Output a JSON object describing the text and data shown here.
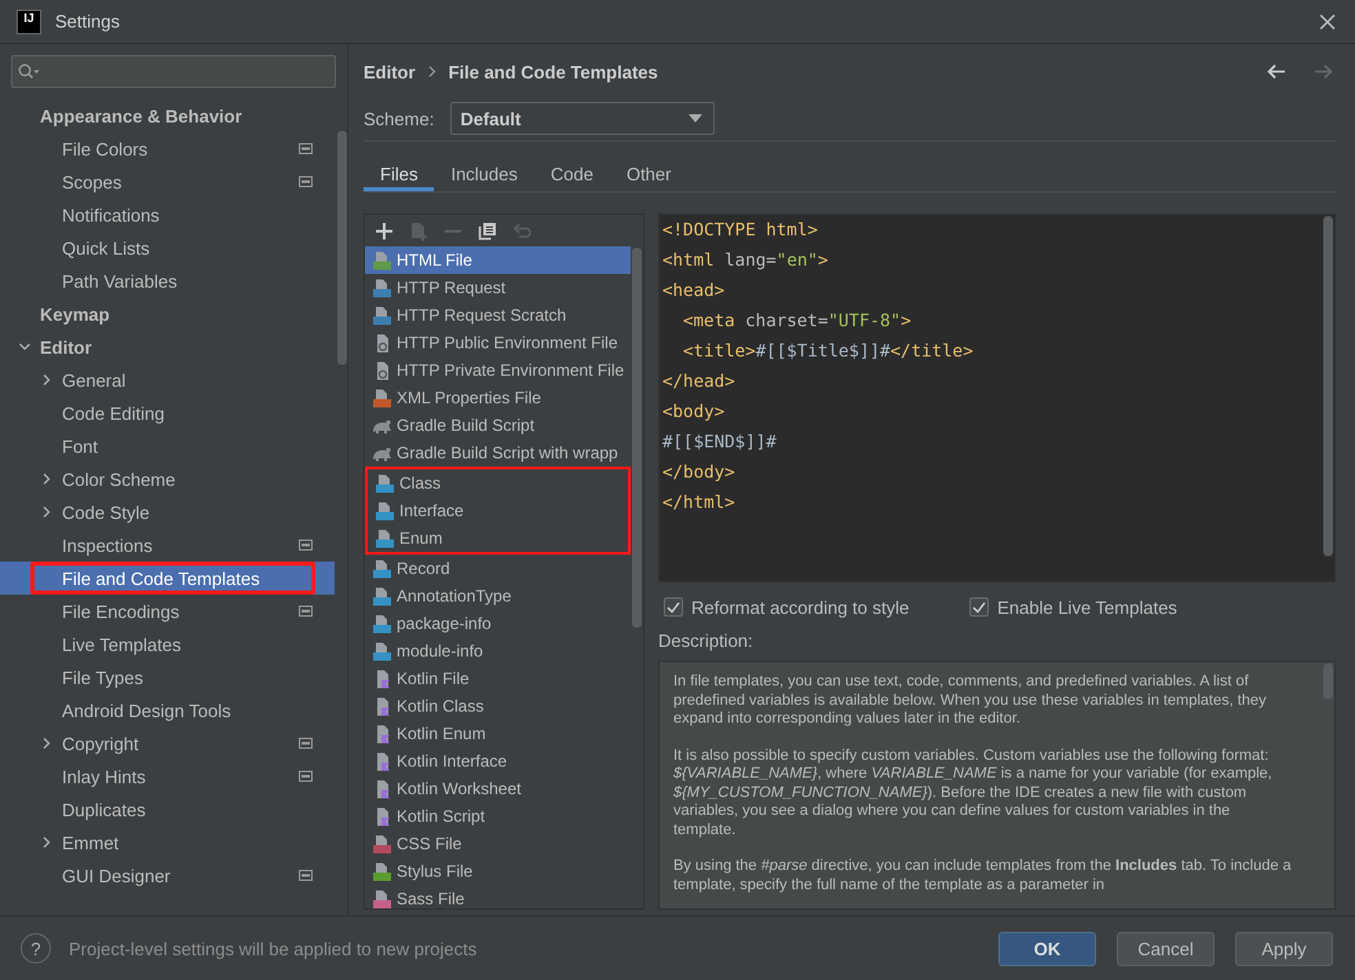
{
  "window": {
    "logo": "IJ",
    "title": "Settings"
  },
  "sidebar": {
    "items": [
      {
        "label": "Appearance & Behavior",
        "kind": "header",
        "children": [
          {
            "label": "File Colors",
            "project_level": true
          },
          {
            "label": "Scopes",
            "project_level": true
          },
          {
            "label": "Notifications"
          },
          {
            "label": "Quick Lists"
          },
          {
            "label": "Path Variables"
          }
        ]
      },
      {
        "label": "Keymap",
        "kind": "header"
      },
      {
        "label": "Editor",
        "kind": "header",
        "expanded": true,
        "children": [
          {
            "label": "General",
            "expanded": false
          },
          {
            "label": "Code Editing"
          },
          {
            "label": "Font"
          },
          {
            "label": "Color Scheme",
            "expanded": false
          },
          {
            "label": "Code Style",
            "expanded": false
          },
          {
            "label": "Inspections",
            "project_level": true
          },
          {
            "label": "File and Code Templates",
            "selected": true,
            "boxed": true
          },
          {
            "label": "File Encodings",
            "project_level": true
          },
          {
            "label": "Live Templates"
          },
          {
            "label": "File Types"
          },
          {
            "label": "Android Design Tools"
          },
          {
            "label": "Copyright",
            "expanded": false,
            "project_level": true
          },
          {
            "label": "Inlay Hints",
            "project_level": true
          },
          {
            "label": "Duplicates"
          },
          {
            "label": "Emmet",
            "expanded": false
          },
          {
            "label": "GUI Designer",
            "project_level": true
          }
        ]
      }
    ]
  },
  "breadcrumb": [
    "Editor",
    "File and Code Templates"
  ],
  "scheme": {
    "label": "Scheme:",
    "value": "Default"
  },
  "tabs": [
    {
      "label": "Files",
      "selected": true
    },
    {
      "label": "Includes",
      "selected": false
    },
    {
      "label": "Code",
      "selected": false
    },
    {
      "label": "Other",
      "selected": false
    }
  ],
  "toolbar": [
    {
      "kind": "add",
      "disabled": false
    },
    {
      "kind": "add-child",
      "disabled": true
    },
    {
      "kind": "remove",
      "disabled": true
    },
    {
      "kind": "copy",
      "disabled": false
    },
    {
      "kind": "reset",
      "disabled": true
    }
  ],
  "templates": [
    {
      "label": "HTML File",
      "kind": "html",
      "selected": true,
      "boxed": false
    },
    {
      "label": "HTTP Request",
      "kind": "api",
      "selected": false,
      "boxed": false
    },
    {
      "label": "HTTP Request Scratch",
      "kind": "api",
      "selected": false,
      "boxed": false
    },
    {
      "label": "HTTP Public Environment File",
      "kind": "env",
      "selected": false,
      "boxed": false
    },
    {
      "label": "HTTP Private Environment File",
      "kind": "env",
      "selected": false,
      "boxed": false
    },
    {
      "label": "XML Properties File",
      "kind": "xml",
      "selected": false,
      "boxed": false
    },
    {
      "label": "Gradle Build Script",
      "kind": "gradle",
      "selected": false,
      "boxed": false
    },
    {
      "label": "Gradle Build Script with wrapp",
      "kind": "gradle",
      "selected": false,
      "boxed": false
    },
    {
      "label": "Class",
      "kind": "java",
      "selected": false,
      "boxed": true
    },
    {
      "label": "Interface",
      "kind": "java",
      "selected": false,
      "boxed": true
    },
    {
      "label": "Enum",
      "kind": "java",
      "selected": false,
      "boxed": true
    },
    {
      "label": "Record",
      "kind": "java",
      "selected": false,
      "boxed": false
    },
    {
      "label": "AnnotationType",
      "kind": "java",
      "selected": false,
      "boxed": false
    },
    {
      "label": "package-info",
      "kind": "java",
      "selected": false,
      "boxed": false
    },
    {
      "label": "module-info",
      "kind": "java",
      "selected": false,
      "boxed": false
    },
    {
      "label": "Kotlin File",
      "kind": "kotlin",
      "selected": false,
      "boxed": false
    },
    {
      "label": "Kotlin Class",
      "kind": "kotlin",
      "selected": false,
      "boxed": false
    },
    {
      "label": "Kotlin Enum",
      "kind": "kotlin",
      "selected": false,
      "boxed": false
    },
    {
      "label": "Kotlin Interface",
      "kind": "kotlin",
      "selected": false,
      "boxed": false
    },
    {
      "label": "Kotlin Worksheet",
      "kind": "kotlin",
      "selected": false,
      "boxed": false
    },
    {
      "label": "Kotlin Script",
      "kind": "kotlin",
      "selected": false,
      "boxed": false
    },
    {
      "label": "CSS File",
      "kind": "css",
      "selected": false,
      "boxed": false
    },
    {
      "label": "Stylus File",
      "kind": "stylus",
      "selected": false,
      "boxed": false
    },
    {
      "label": "Sass File",
      "kind": "sass",
      "selected": false,
      "boxed": false
    }
  ],
  "code_lines": [
    {
      "indent": false,
      "tokens": [
        {
          "kind": "tag",
          "text": "<!DOCTYPE html>"
        }
      ]
    },
    {
      "indent": false,
      "tokens": [
        {
          "kind": "tag",
          "text": "<html "
        },
        {
          "kind": "attr",
          "text": "lang="
        },
        {
          "kind": "value",
          "text": "\"en\""
        },
        {
          "kind": "tag",
          "text": ">"
        }
      ]
    },
    {
      "indent": false,
      "tokens": [
        {
          "kind": "tag",
          "text": "<head>"
        }
      ]
    },
    {
      "indent": true,
      "tokens": [
        {
          "kind": "tag",
          "text": "<meta "
        },
        {
          "kind": "attr",
          "text": "charset="
        },
        {
          "kind": "value",
          "text": "\"UTF-8\""
        },
        {
          "kind": "tag",
          "text": ">"
        }
      ]
    },
    {
      "indent": true,
      "tokens": [
        {
          "kind": "tag",
          "text": "<title>"
        },
        {
          "kind": "text",
          "text": "#[[$Title$]]#"
        },
        {
          "kind": "tag",
          "text": "</title>"
        }
      ]
    },
    {
      "indent": false,
      "tokens": [
        {
          "kind": "tag",
          "text": "</head>"
        }
      ]
    },
    {
      "indent": false,
      "tokens": [
        {
          "kind": "tag",
          "text": "<body>"
        }
      ]
    },
    {
      "indent": false,
      "tokens": [
        {
          "kind": "text",
          "text": "#[[$END$]]#"
        }
      ]
    },
    {
      "indent": false,
      "tokens": [
        {
          "kind": "tag",
          "text": "</body>"
        }
      ]
    },
    {
      "indent": false,
      "tokens": [
        {
          "kind": "tag",
          "text": "</html>"
        }
      ]
    }
  ],
  "options": [
    {
      "label": "Reformat according to style",
      "checked": true
    },
    {
      "label": "Enable Live Templates",
      "checked": true
    }
  ],
  "description": {
    "label": "Description:",
    "paragraphs": [
      "In file templates, you can use text, code, comments, and predefined variables. A list of predefined variables is available below. When you use these variables in templates, they expand into corresponding values later in the editor.",
      "It is also possible to specify custom variables. Custom variables use the following format: *${VARIABLE_NAME}*, where *VARIABLE_NAME* is a name for your variable (for example, *${MY_CUSTOM_FUNCTION_NAME}*). Before the IDE creates a new file with custom variables, you see a dialog where you can define values for custom variables in the template.",
      "By using the *#parse* directive, you can include templates from the **Includes** tab. To include a template, specify the full name of the template as a parameter in"
    ]
  },
  "footer": {
    "help": "?",
    "note": "Project-level settings will be applied to new projects",
    "buttons": [
      {
        "label": "OK",
        "default": true
      },
      {
        "label": "Cancel",
        "default": false
      },
      {
        "label": "Apply",
        "default": false
      }
    ]
  }
}
